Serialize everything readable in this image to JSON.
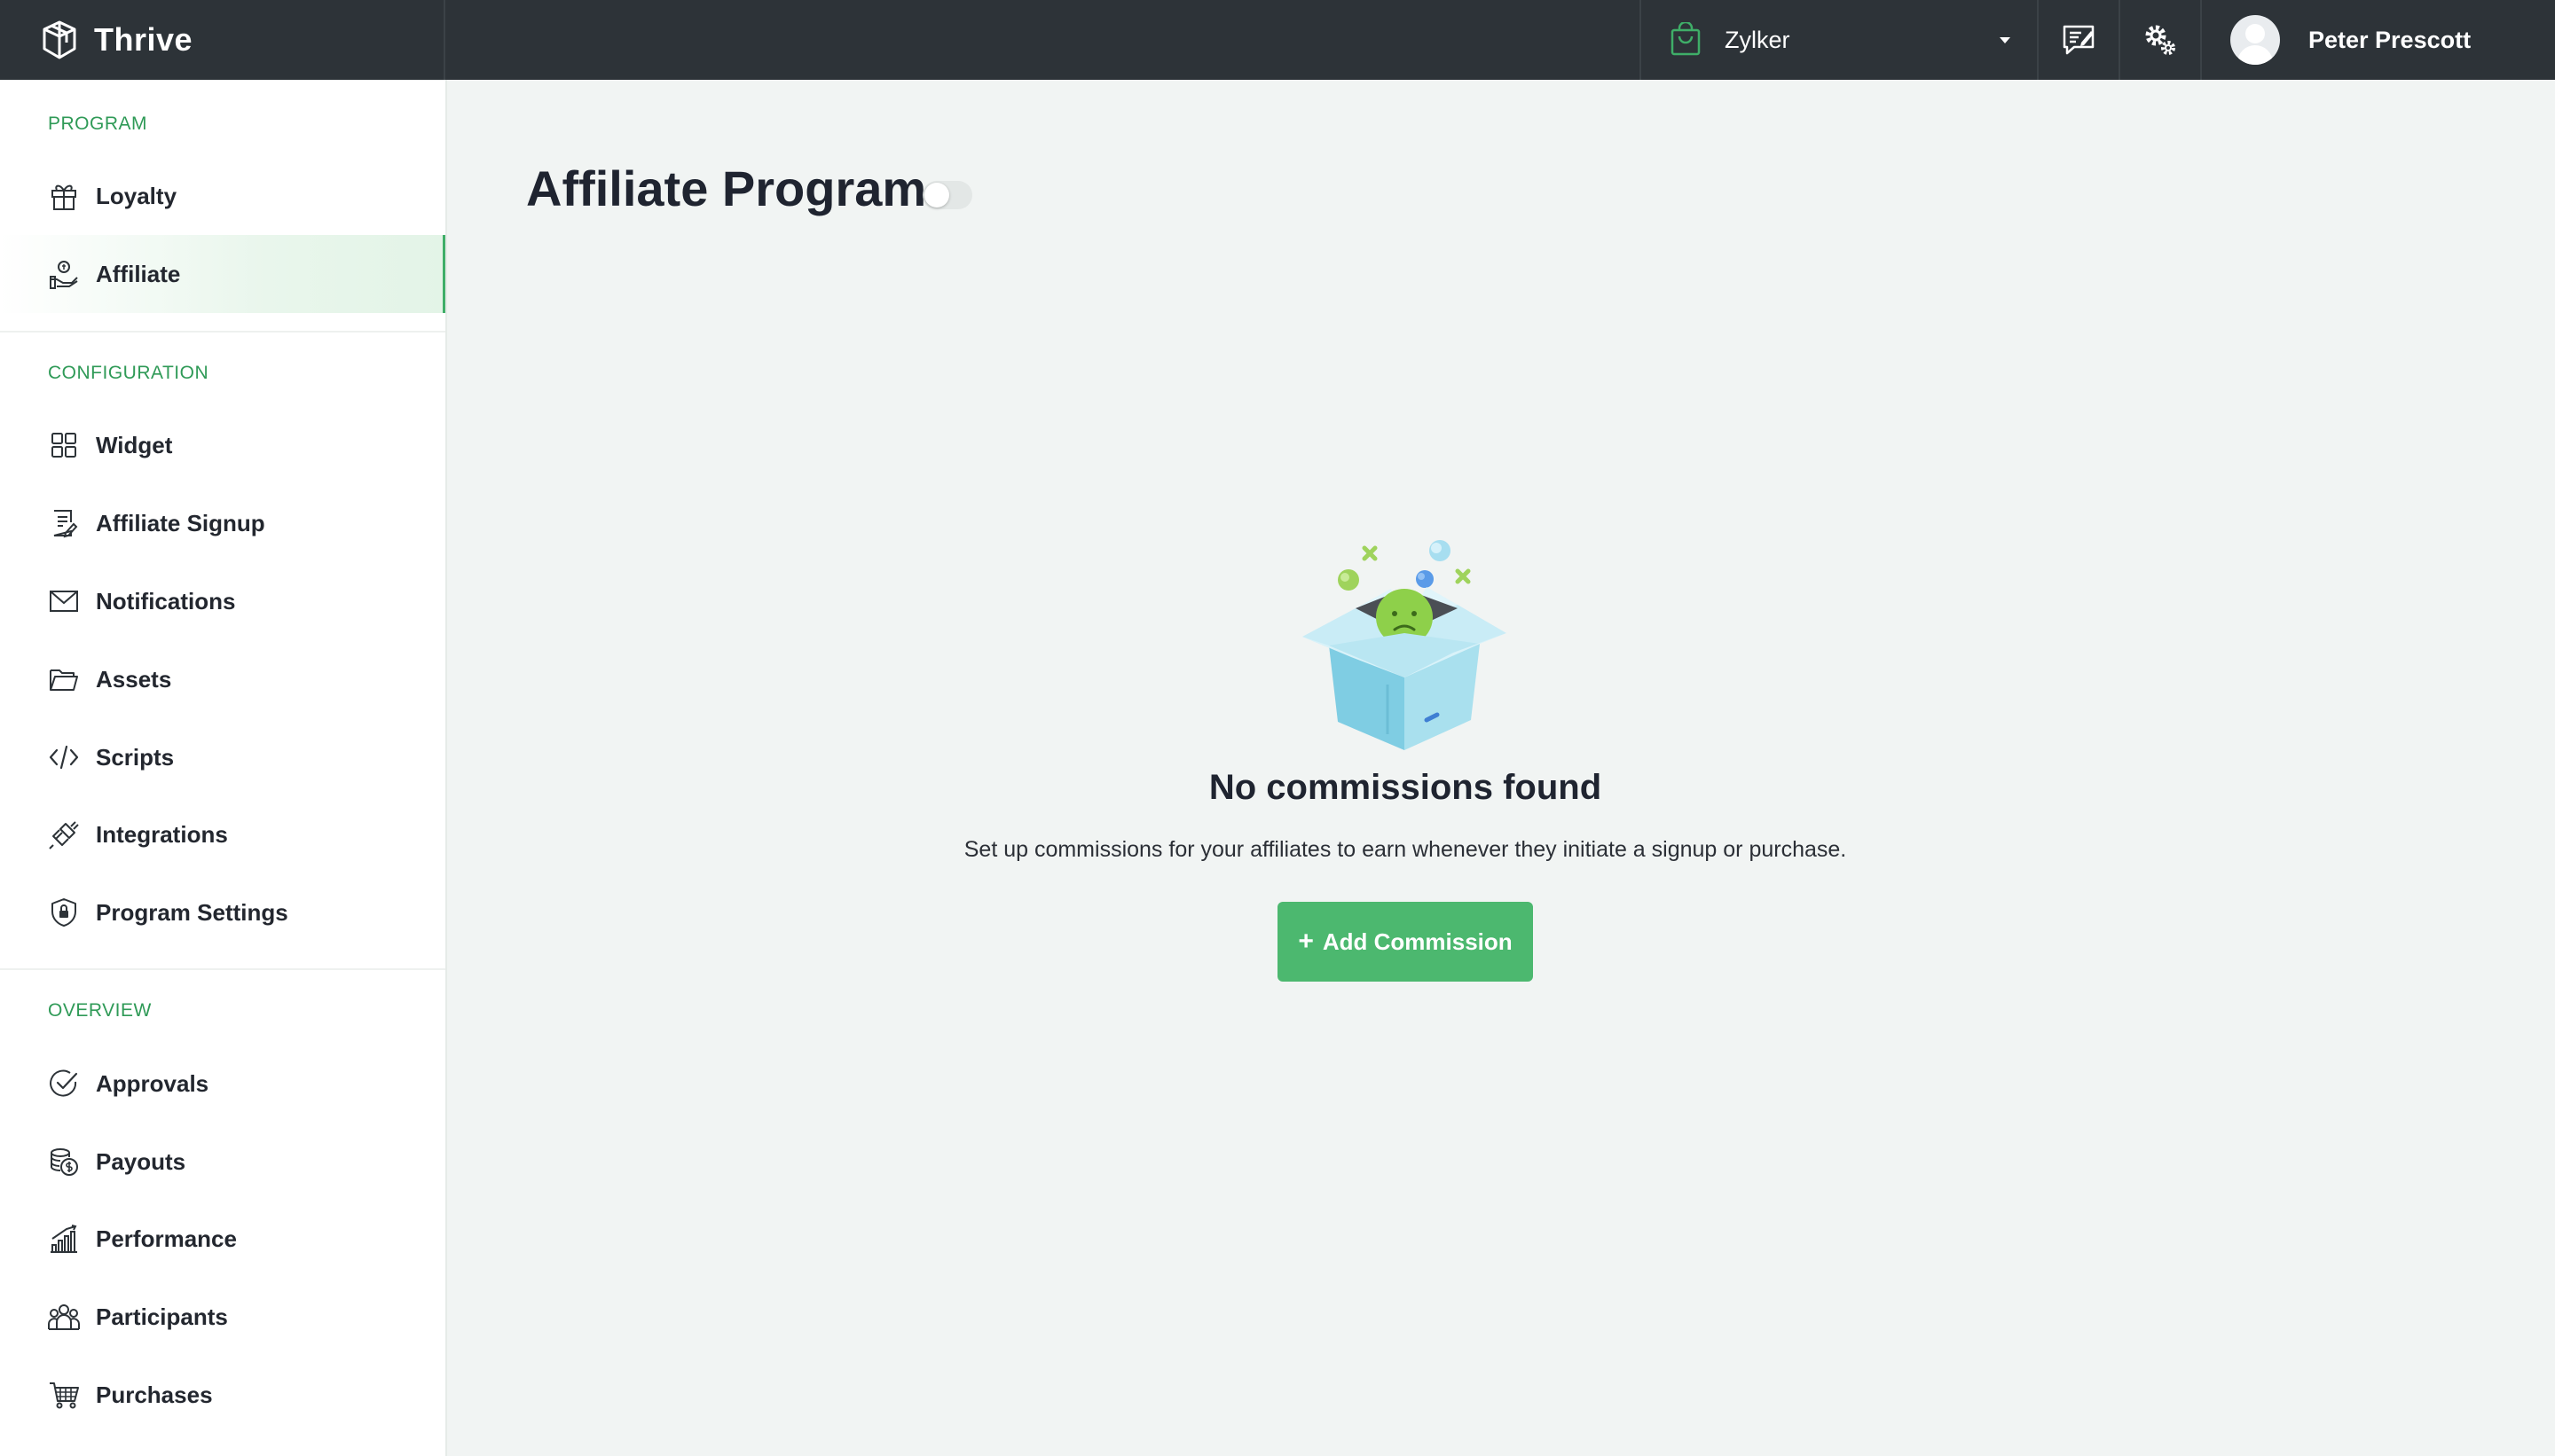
{
  "app": {
    "name": "Thrive"
  },
  "header": {
    "org_name": "Zylker",
    "user_name": "Peter Prescott"
  },
  "sidebar": {
    "sections": [
      {
        "label": "PROGRAM",
        "items": [
          {
            "label": "Loyalty",
            "icon": "gift-icon"
          },
          {
            "label": "Affiliate",
            "icon": "affiliate-icon",
            "active": true
          }
        ]
      },
      {
        "label": "CONFIGURATION",
        "items": [
          {
            "label": "Widget",
            "icon": "grid-icon"
          },
          {
            "label": "Affiliate Signup",
            "icon": "signup-form-icon"
          },
          {
            "label": "Notifications",
            "icon": "envelope-icon"
          },
          {
            "label": "Assets",
            "icon": "folder-icon"
          },
          {
            "label": "Scripts",
            "icon": "code-icon"
          },
          {
            "label": "Integrations",
            "icon": "plug-icon"
          },
          {
            "label": "Program Settings",
            "icon": "shield-lock-icon"
          }
        ]
      },
      {
        "label": "OVERVIEW",
        "items": [
          {
            "label": "Approvals",
            "icon": "check-circle-icon"
          },
          {
            "label": "Payouts",
            "icon": "coins-icon"
          },
          {
            "label": "Performance",
            "icon": "bar-chart-icon"
          },
          {
            "label": "Participants",
            "icon": "people-icon"
          },
          {
            "label": "Purchases",
            "icon": "cart-icon"
          }
        ]
      }
    ]
  },
  "main": {
    "title": "Affiliate Program",
    "program_enabled": false,
    "empty_state": {
      "title": "No commissions found",
      "description": "Set up commissions for your affiliates to earn whenever they initiate a signup or purchase.",
      "button_label": "Add Commission",
      "button_icon": "plus-icon"
    }
  },
  "colors": {
    "topbar": "#2d3338",
    "accent": "#4cb86f",
    "section_label": "#2f9a57",
    "background": "#f1f4f3"
  }
}
